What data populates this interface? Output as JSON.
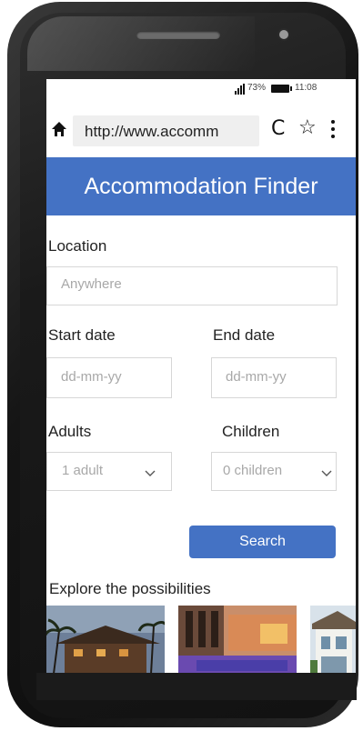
{
  "status_bar": {
    "battery_percent": "73%",
    "time": "11:08"
  },
  "browser": {
    "url": "http://www.accomm"
  },
  "header": {
    "title": "Accommodation Finder"
  },
  "form": {
    "location": {
      "label": "Location",
      "placeholder": "Anywhere"
    },
    "start_date": {
      "label": "Start date",
      "placeholder": "dd-mm-yy"
    },
    "end_date": {
      "label": "End date",
      "placeholder": "dd-mm-yy"
    },
    "adults": {
      "label": "Adults",
      "value": "1 adult"
    },
    "children": {
      "label": "Children",
      "value": "0 children"
    },
    "search_label": "Search"
  },
  "explore": {
    "title": "Explore the possibilities"
  },
  "colors": {
    "accent": "#4472c4"
  }
}
